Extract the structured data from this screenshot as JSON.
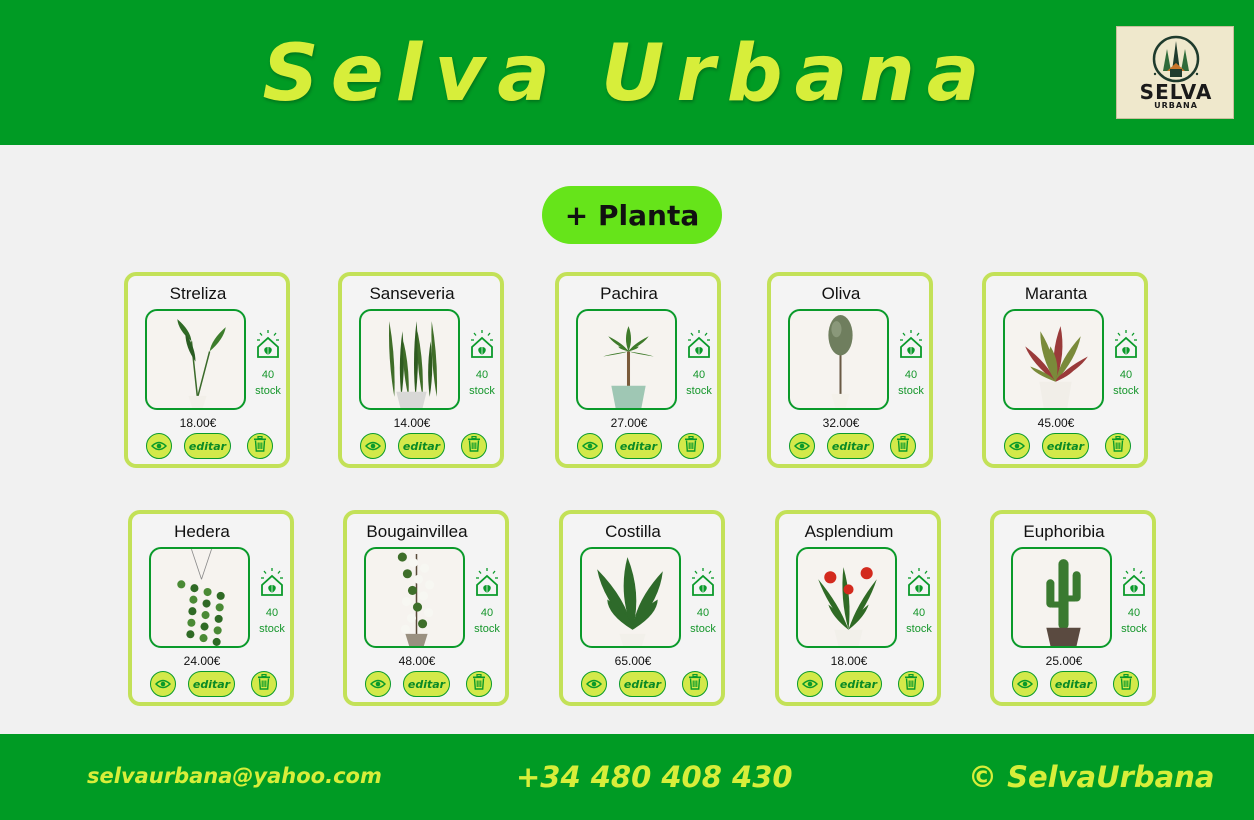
{
  "header": {
    "title": "Selva Urbana",
    "logo_text": "SELVA",
    "logo_subtext": "URBANA"
  },
  "add_button_label": "+ Planta",
  "card_labels": {
    "stock": "stock",
    "edit": "editar"
  },
  "colors": {
    "brand_green": "#009b24",
    "accent_lime": "#d7ee3a",
    "card_border": "#c3e158",
    "button_fill": "#d3e94a",
    "add_button": "#66e41a"
  },
  "plants": [
    {
      "name": "Streliza",
      "price": "18.00€",
      "stock": "40",
      "photo": "bird-of-paradise"
    },
    {
      "name": "Sanseveria",
      "price": "14.00€",
      "stock": "40",
      "photo": "snake-plant"
    },
    {
      "name": "Pachira",
      "price": "27.00€",
      "stock": "40",
      "photo": "money-tree"
    },
    {
      "name": "Oliva",
      "price": "32.00€",
      "stock": "40",
      "photo": "olive-tree"
    },
    {
      "name": "Maranta",
      "price": "45.00€",
      "stock": "40",
      "photo": "prayer-plant"
    },
    {
      "name": "Hedera",
      "price": "24.00€",
      "stock": "40",
      "photo": "hanging-ivy"
    },
    {
      "name": "Bougainvillea",
      "price": "48.00€",
      "stock": "40",
      "photo": "bougainvillea"
    },
    {
      "name": "Costilla",
      "price": "65.00€",
      "stock": "40",
      "photo": "monstera"
    },
    {
      "name": "Asplendium",
      "price": "18.00€",
      "stock": "40",
      "photo": "anthurium"
    },
    {
      "name": "Euphoribia",
      "price": "25.00€",
      "stock": "40",
      "photo": "cactus"
    }
  ],
  "footer": {
    "email": "selvaurbana@yahoo.com",
    "phone": "+34 480 408 430",
    "copyright": "© SelvaUrbana"
  }
}
